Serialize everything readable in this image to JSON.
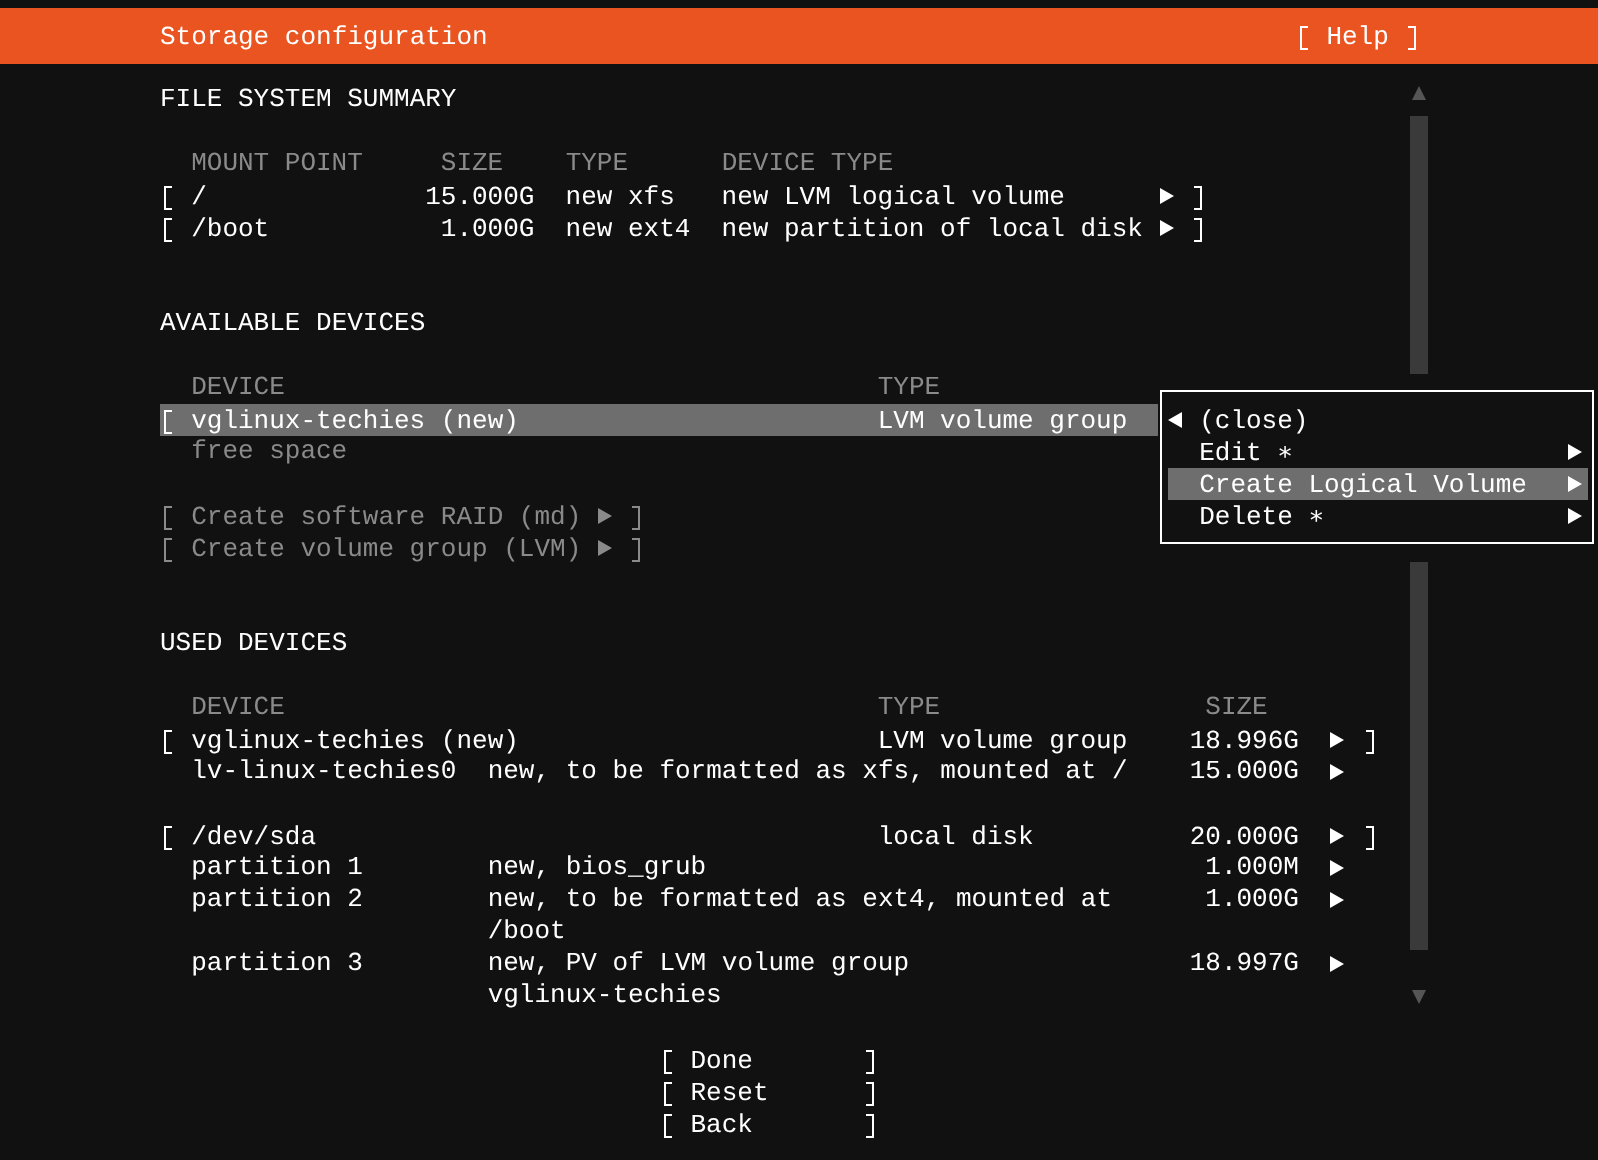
{
  "header": {
    "title": "Storage configuration",
    "help": "Help"
  },
  "file_system_summary": {
    "heading": "FILE SYSTEM SUMMARY",
    "columns": [
      "MOUNT POINT",
      "SIZE",
      "TYPE",
      "DEVICE TYPE"
    ],
    "rows": [
      {
        "mount_point": "/",
        "size": "15.000G",
        "type": "new xfs",
        "device_type": "new LVM logical volume"
      },
      {
        "mount_point": "/boot",
        "size": "1.000G",
        "type": "new ext4",
        "device_type": "new partition of local disk"
      }
    ]
  },
  "available_devices": {
    "heading": "AVAILABLE DEVICES",
    "columns": [
      "DEVICE",
      "TYPE"
    ],
    "rows": [
      {
        "kind": "device",
        "device": "vglinux-techies (new)",
        "type": "LVM volume group",
        "selected": true
      },
      {
        "kind": "free",
        "device": "free space",
        "selected": false
      }
    ],
    "actions": [
      {
        "label": "Create software RAID (md)",
        "disabled": true
      },
      {
        "label": "Create volume group (LVM)",
        "disabled": true
      }
    ]
  },
  "menu": {
    "items": [
      {
        "kind": "close",
        "label": "(close)",
        "selected": false
      },
      {
        "kind": "submenu",
        "label": "Edit ∗",
        "selected": false
      },
      {
        "kind": "submenu",
        "label": "Create Logical Volume",
        "selected": true
      },
      {
        "kind": "submenu",
        "label": "Delete ∗",
        "selected": false
      }
    ]
  },
  "used_devices": {
    "heading": "USED DEVICES",
    "columns": [
      "DEVICE",
      "TYPE",
      "SIZE"
    ],
    "groups": [
      {
        "device": "vglinux-techies (new)",
        "type": "LVM volume group",
        "size": "18.996G",
        "children": [
          {
            "name": "lv-linux-techies0",
            "description": "new, to be formatted as xfs, mounted at /",
            "size": "15.000G"
          }
        ]
      },
      {
        "device": "/dev/sda",
        "type": "local disk",
        "size": "20.000G",
        "children": [
          {
            "name": "partition 1",
            "description": "new, bios_grub",
            "size": "1.000M"
          },
          {
            "name": "partition 2",
            "description": "new, to be formatted as ext4, mounted at /boot",
            "size": "1.000G"
          },
          {
            "name": "partition 3",
            "description": "new, PV of LVM volume group vglinux-techies",
            "size": "18.997G"
          }
        ]
      }
    ]
  },
  "buttons": [
    {
      "label": "Done"
    },
    {
      "label": "Reset"
    },
    {
      "label": "Back"
    }
  ]
}
